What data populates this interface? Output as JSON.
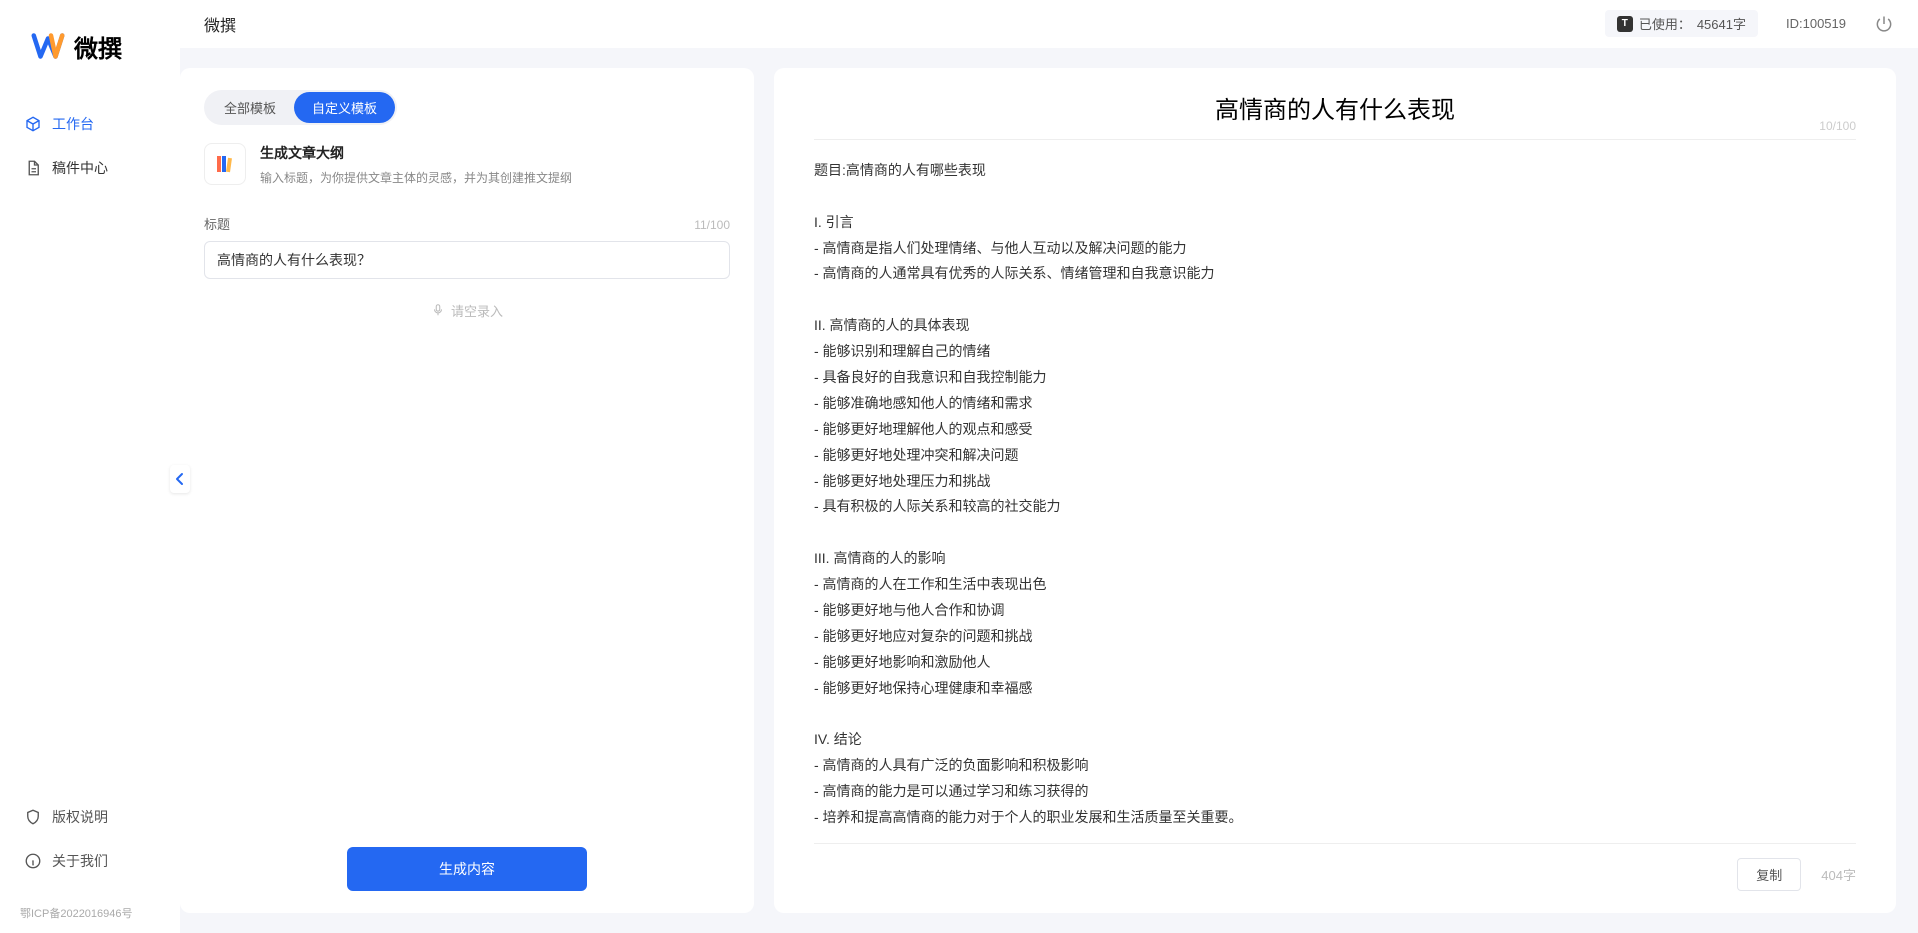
{
  "brand": {
    "name": "微撰"
  },
  "nav": {
    "workspace": "工作台",
    "drafts": "稿件中心"
  },
  "sidebar_bottom": {
    "copyright": "版权说明",
    "about": "关于我们"
  },
  "icp": "鄂ICP备2022016946号",
  "topbar": {
    "title": "微撰",
    "usage_label": "已使用：",
    "usage_value": "45641字",
    "id_label": "ID:",
    "id_value": "100519"
  },
  "left": {
    "tab_all": "全部模板",
    "tab_custom": "自定义模板",
    "template_title": "生成文章大纲",
    "template_desc": "输入标题，为你提供文章主体的灵感，并为其创建推文提纲",
    "field_label": "标题",
    "field_counter": "11/100",
    "input_value": "高情商的人有什么表现？",
    "voice_hint": "请空录入",
    "generate": "生成内容"
  },
  "right": {
    "title": "高情商的人有什么表现",
    "title_counter": "10/100",
    "body": "题目:高情商的人有哪些表现\n\nI. 引言\n- 高情商是指人们处理情绪、与他人互动以及解决问题的能力\n- 高情商的人通常具有优秀的人际关系、情绪管理和自我意识能力\n\nII. 高情商的人的具体表现\n- 能够识别和理解自己的情绪\n- 具备良好的自我意识和自我控制能力\n- 能够准确地感知他人的情绪和需求\n- 能够更好地理解他人的观点和感受\n- 能够更好地处理冲突和解决问题\n- 能够更好地处理压力和挑战\n- 具有积极的人际关系和较高的社交能力\n\nIII. 高情商的人的影响\n- 高情商的人在工作和生活中表现出色\n- 能够更好地与他人合作和协调\n- 能够更好地应对复杂的问题和挑战\n- 能够更好地影响和激励他人\n- 能够更好地保持心理健康和幸福感\n\nIV. 结论\n- 高情商的人具有广泛的负面影响和积极影响\n- 高情商的能力是可以通过学习和练习获得的\n- 培养和提高高情商的能力对于个人的职业发展和生活质量至关重要。",
    "copy": "复制",
    "char_count": "404字"
  }
}
